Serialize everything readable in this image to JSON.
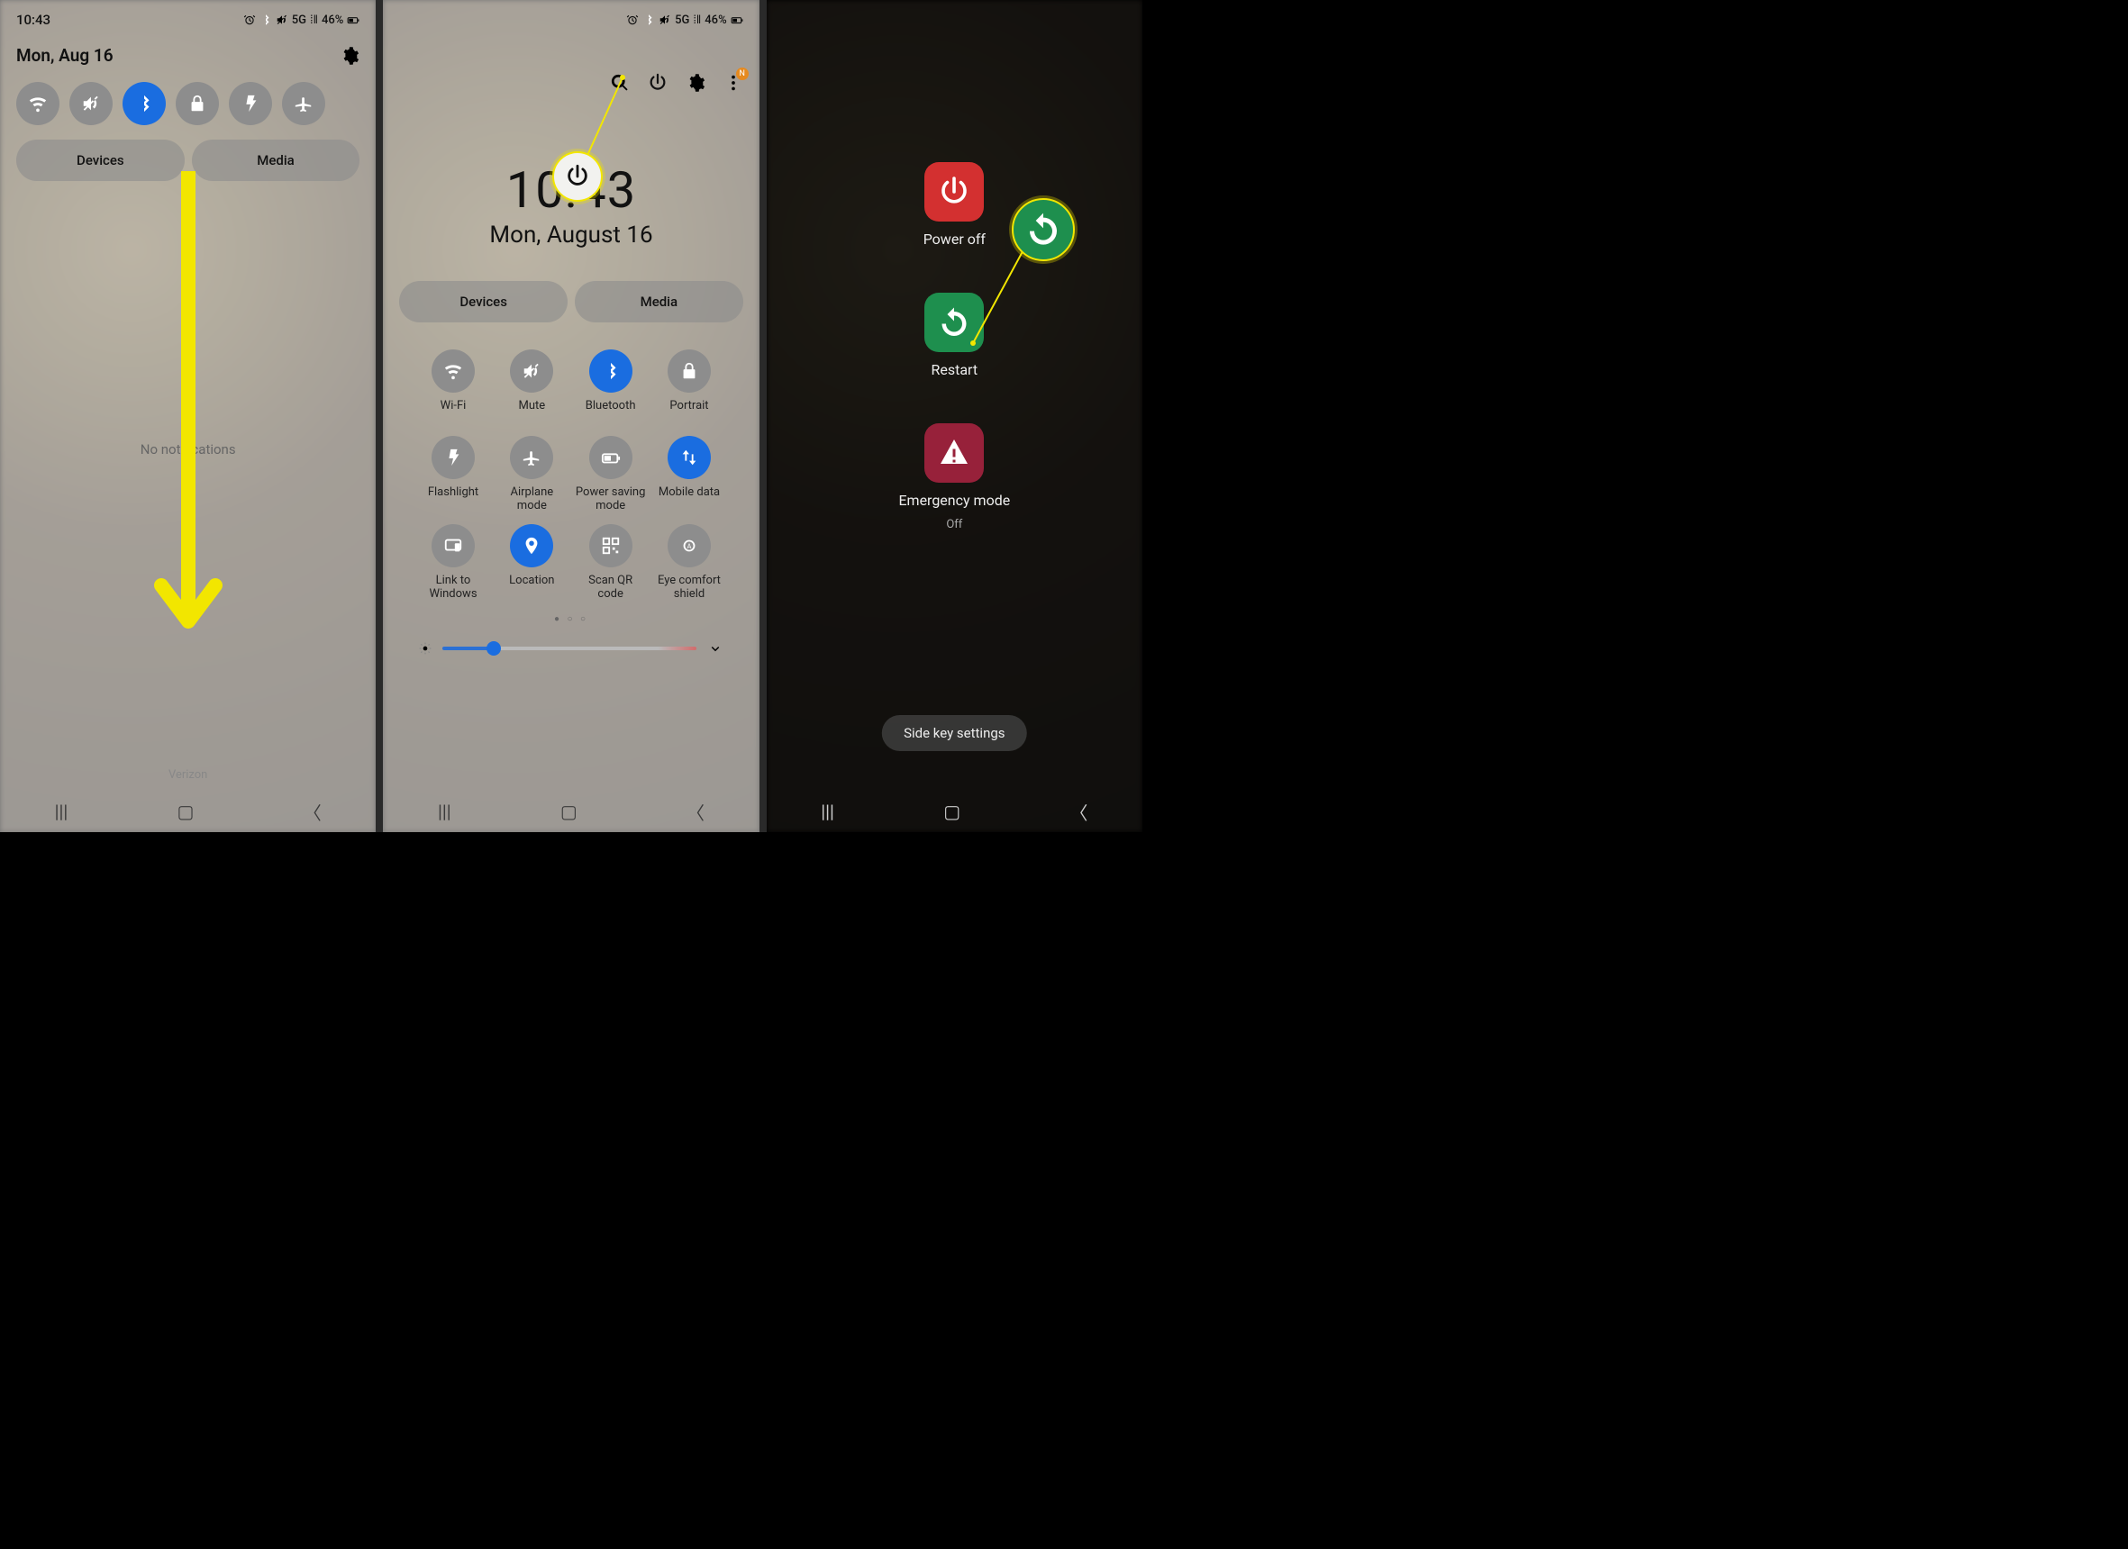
{
  "status": {
    "time": "10:43",
    "network": "5G",
    "battery": "46%"
  },
  "panel1": {
    "date": "Mon, Aug 16",
    "pills": {
      "devices": "Devices",
      "media": "Media"
    },
    "no_notifications": "No notifications",
    "carrier": "Verizon"
  },
  "panel2": {
    "clock_time": "10:43",
    "clock_date": "Mon, August 16",
    "pills": {
      "devices": "Devices",
      "media": "Media"
    },
    "tiles": [
      {
        "key": "wifi",
        "label": "Wi-Fi",
        "active": false
      },
      {
        "key": "mute",
        "label": "Mute",
        "active": false
      },
      {
        "key": "bluetooth",
        "label": "Bluetooth",
        "active": true
      },
      {
        "key": "portrait",
        "label": "Portrait",
        "active": false
      },
      {
        "key": "flashlight",
        "label": "Flashlight",
        "active": false
      },
      {
        "key": "airplane",
        "label": "Airplane mode",
        "active": false
      },
      {
        "key": "powersave",
        "label": "Power saving mode",
        "active": false
      },
      {
        "key": "mobiledata",
        "label": "Mobile data",
        "active": true
      },
      {
        "key": "linkwin",
        "label": "Link to Windows",
        "active": false
      },
      {
        "key": "location",
        "label": "Location",
        "active": true
      },
      {
        "key": "qr",
        "label": "Scan QR code",
        "active": false
      },
      {
        "key": "eyecomfort",
        "label": "Eye comfort shield",
        "active": false
      }
    ],
    "badge": "N"
  },
  "panel3": {
    "power_off": "Power off",
    "restart": "Restart",
    "emergency": "Emergency mode",
    "emergency_state": "Off",
    "side_key": "Side key settings"
  },
  "icons": {
    "wifi": "wifi",
    "mute": "mute",
    "bluetooth": "bt",
    "lock": "lock",
    "flashlight": "flash",
    "airplane": "plane",
    "gear": "gear",
    "search": "search",
    "power": "power",
    "menu": "menu"
  }
}
